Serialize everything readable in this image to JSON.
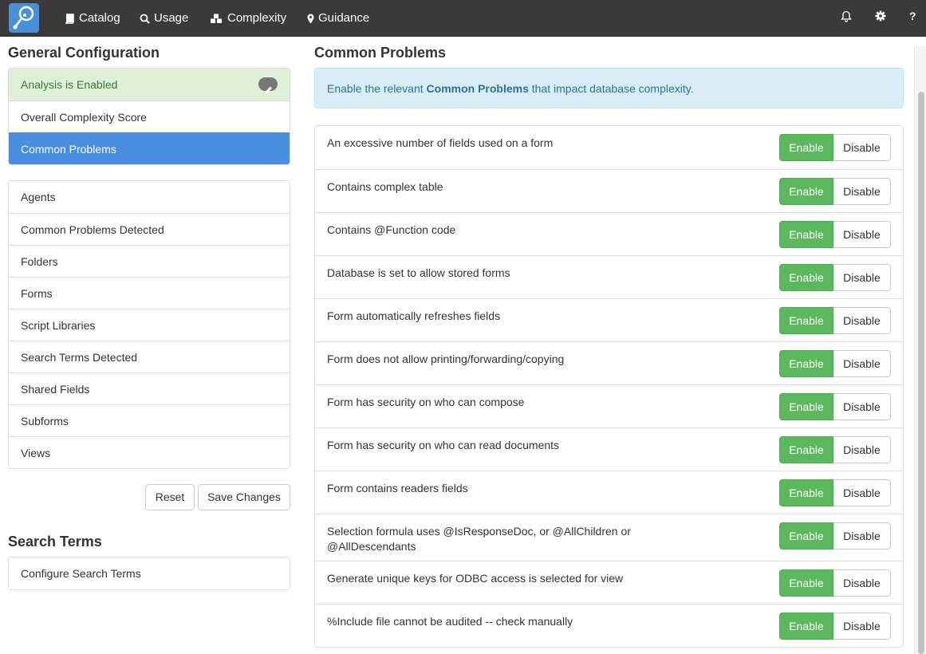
{
  "nav": {
    "links": [
      {
        "label": "Catalog",
        "icon": "book-icon"
      },
      {
        "label": "Usage",
        "icon": "search-icon"
      },
      {
        "label": "Complexity",
        "icon": "cubes-icon"
      },
      {
        "label": "Guidance",
        "icon": "map-marker-icon"
      }
    ],
    "help_label": "?"
  },
  "general": {
    "title": "General Configuration",
    "items": [
      {
        "label": "Analysis is Enabled",
        "state": "success"
      },
      {
        "label": "Overall Complexity Score",
        "state": "normal"
      },
      {
        "label": "Common Problems",
        "state": "active"
      }
    ]
  },
  "categories": {
    "items": [
      "Agents",
      "Common Problems Detected",
      "Folders",
      "Forms",
      "Script Libraries",
      "Search Terms Detected",
      "Shared Fields",
      "Subforms",
      "Views"
    ]
  },
  "actions": {
    "reset": "Reset",
    "save": "Save Changes"
  },
  "search_terms": {
    "title": "Search Terms",
    "item": "Configure Search Terms"
  },
  "main": {
    "title": "Common Problems",
    "alert_prefix": "Enable the relevant ",
    "alert_bold": "Common Problems",
    "alert_suffix": " that impact database complexity.",
    "enable_label": "Enable",
    "disable_label": "Disable",
    "problems": [
      {
        "label": "An excessive number of fields used on a form",
        "enabled": true
      },
      {
        "label": "Contains complex table",
        "enabled": true
      },
      {
        "label": "Contains @Function code",
        "enabled": true
      },
      {
        "label": "Database is set to allow stored forms",
        "enabled": true
      },
      {
        "label": "Form automatically refreshes fields",
        "enabled": true
      },
      {
        "label": "Form does not allow printing/forwarding/copying",
        "enabled": true
      },
      {
        "label": "Form has security on who can compose",
        "enabled": true
      },
      {
        "label": "Form has security on who can read documents",
        "enabled": true
      },
      {
        "label": "Form contains readers fields",
        "enabled": true
      },
      {
        "label": "Selection formula uses @IsResponseDoc, or @AllChildren or @AllDescendants",
        "enabled": true
      },
      {
        "label": "Generate unique keys for ODBC access is selected for view",
        "enabled": true
      },
      {
        "label": "%Include file cannot be audited -- check manually",
        "enabled": true
      }
    ]
  },
  "colors": {
    "nav_bg": "#3a3a3a",
    "brand": "#4a90d9",
    "active": "#4a8ee0",
    "enable": "#5cb85c",
    "success_bg": "#dff0d8",
    "alert_bg": "#d9edf7"
  }
}
